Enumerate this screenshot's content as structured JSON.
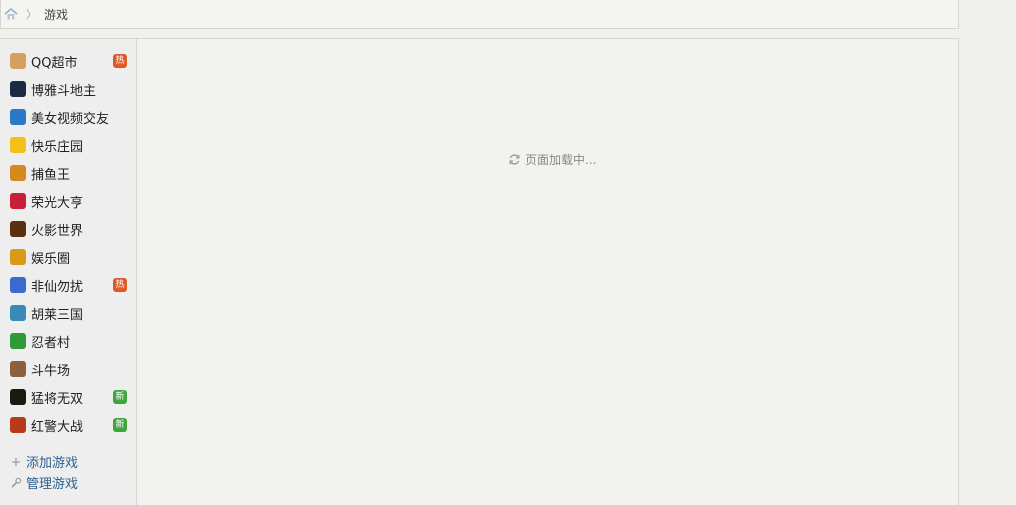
{
  "breadcrumb": {
    "home_icon": "home-icon",
    "separator": "〉",
    "current": "游戏"
  },
  "sidebar": {
    "games": [
      {
        "label": "QQ超市",
        "icon": "qq-supermarket-icon",
        "icon_color": "#d8a060",
        "badge": "热",
        "badge_color": "#e05a28"
      },
      {
        "label": "博雅斗地主",
        "icon": "boyaa-landlord-icon",
        "icon_color": "#1c2a44",
        "badge": "",
        "badge_color": ""
      },
      {
        "label": "美女视频交友",
        "icon": "video-dating-icon",
        "icon_color": "#2a78c8",
        "badge": "",
        "badge_color": ""
      },
      {
        "label": "快乐庄园",
        "icon": "happy-farm-icon",
        "icon_color": "#f2c21a",
        "badge": "",
        "badge_color": ""
      },
      {
        "label": "捕鱼王",
        "icon": "fishing-king-icon",
        "icon_color": "#d48a20",
        "badge": "",
        "badge_color": ""
      },
      {
        "label": "荣光大亨",
        "icon": "glory-tycoon-icon",
        "icon_color": "#c8203a",
        "badge": "",
        "badge_color": ""
      },
      {
        "label": "火影世界",
        "icon": "naruto-world-icon",
        "icon_color": "#5a3010",
        "badge": "",
        "badge_color": ""
      },
      {
        "label": "娱乐圈",
        "icon": "entertainment-circle-icon",
        "icon_color": "#d89a18",
        "badge": "",
        "badge_color": ""
      },
      {
        "label": "非仙勿扰",
        "icon": "immortal-dating-icon",
        "icon_color": "#3a6ad0",
        "badge": "热",
        "badge_color": "#e05a28"
      },
      {
        "label": "胡莱三国",
        "icon": "hulai-three-kingdoms-icon",
        "icon_color": "#3a8ab8",
        "badge": "",
        "badge_color": ""
      },
      {
        "label": "忍者村",
        "icon": "ninja-village-icon",
        "icon_color": "#2e9a3a",
        "badge": "",
        "badge_color": ""
      },
      {
        "label": "斗牛场",
        "icon": "bullring-icon",
        "icon_color": "#8a6040",
        "badge": "",
        "badge_color": ""
      },
      {
        "label": "猛将无双",
        "icon": "fierce-general-icon",
        "icon_color": "#1a1a10",
        "badge": "新",
        "badge_color": "#3fa53f"
      },
      {
        "label": "红警大战",
        "icon": "red-alert-icon",
        "icon_color": "#b83a1a",
        "badge": "新",
        "badge_color": "#3fa53f"
      }
    ],
    "actions": [
      {
        "label": "添加游戏",
        "icon": "plus-icon"
      },
      {
        "label": "管理游戏",
        "icon": "wrench-icon"
      }
    ]
  },
  "main": {
    "loading_icon": "refresh-icon",
    "loading_text": "页面加载中..."
  }
}
